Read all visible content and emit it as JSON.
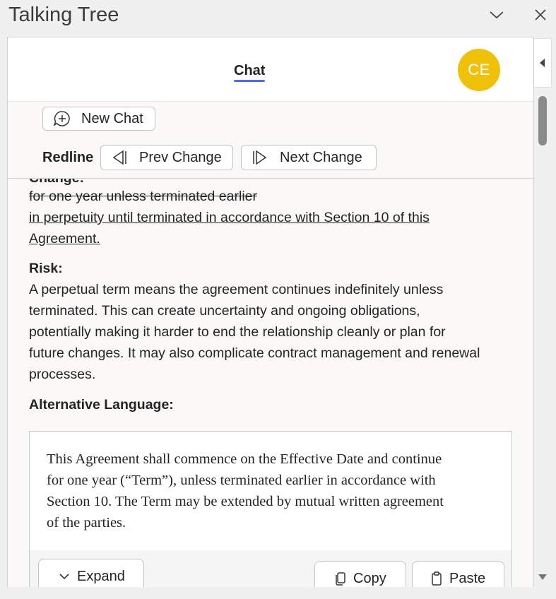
{
  "window": {
    "title": "Talking Tree"
  },
  "header": {
    "chat_tab": "Chat",
    "avatar_initials": "CE",
    "avatar_color": "#efc109"
  },
  "toolbar": {
    "new_chat_label": "New Chat",
    "redline_label": "Redline",
    "prev_change_label": "Prev Change",
    "next_change_label": "Next Change"
  },
  "content": {
    "change_heading": "Change:",
    "deleted_text": "for one year unless terminated earlier",
    "inserted_line1": "in perpetuity until terminated in accordance with Section 10 of this",
    "inserted_line2": "Agreement.",
    "risk_heading": "Risk:",
    "risk_lines": [
      "A perpetual term means the agreement continues indefinitely unless",
      "terminated. This can create uncertainty and ongoing obligations,",
      "potentially making it harder to end the relationship cleanly or plan for",
      "future changes. It may also complicate contract management and renewal",
      "processes."
    ],
    "alt_heading": "Alternative Language:",
    "alt_lines": [
      "This Agreement shall commence on the Effective Date and continue",
      "for one year (“Term”), unless terminated earlier in accordance with",
      "Section 10. The Term may be extended by mutual written agreement",
      "of the parties."
    ],
    "expand_label": "Expand",
    "copy_label": "Copy",
    "paste_label": "Paste"
  },
  "colors": {
    "accent": "#4f6bed",
    "avatar": "#efc109"
  }
}
